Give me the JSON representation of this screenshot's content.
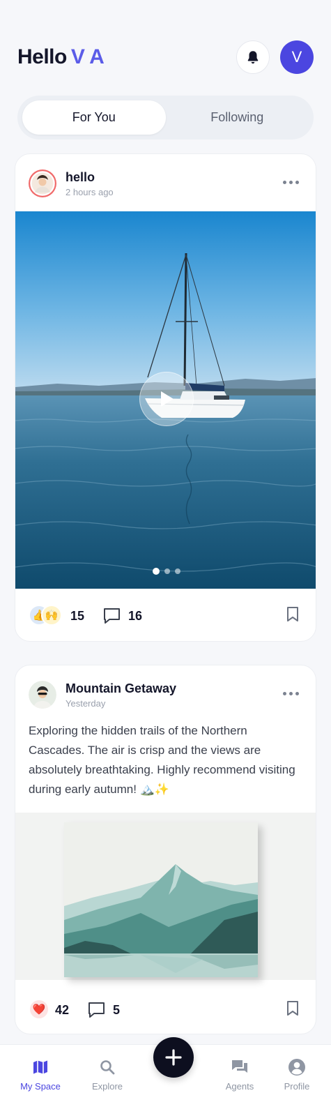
{
  "header": {
    "hello": "Hello",
    "name": "V A",
    "avatar_initial": "V"
  },
  "tabs": [
    {
      "label": "For You",
      "active": true
    },
    {
      "label": "Following",
      "active": false
    }
  ],
  "posts": [
    {
      "user": "hello",
      "time": "2 hours ago",
      "media": "sailboat-video",
      "reactions": [
        "👍",
        "🙌"
      ],
      "reaction_count": "15",
      "comment_count": "16",
      "carousel": {
        "count": 3,
        "active": 0
      }
    },
    {
      "user": "Mountain Getaway",
      "time": "Yesterday",
      "text": "Exploring the hidden trails of the Northern Cascades. The air is crisp and the views are absolutely breathtaking. Highly recommend visiting during early autumn! 🏔️✨",
      "media": "mountain-canvas",
      "reactions": [
        "❤️"
      ],
      "reaction_count": "42",
      "comment_count": "5"
    }
  ],
  "nav": {
    "items": [
      {
        "label": "My Space",
        "icon": "map-icon",
        "active": true
      },
      {
        "label": "Explore",
        "icon": "search-icon",
        "active": false
      },
      {
        "label": "Agents",
        "icon": "chat-icon",
        "active": false
      },
      {
        "label": "Profile",
        "icon": "user-icon",
        "active": false
      }
    ],
    "fab_icon": "plus-icon"
  },
  "colors": {
    "accent": "#4b46e0",
    "name_accent": "#5b5ce8",
    "background": "#f6f7fa"
  }
}
